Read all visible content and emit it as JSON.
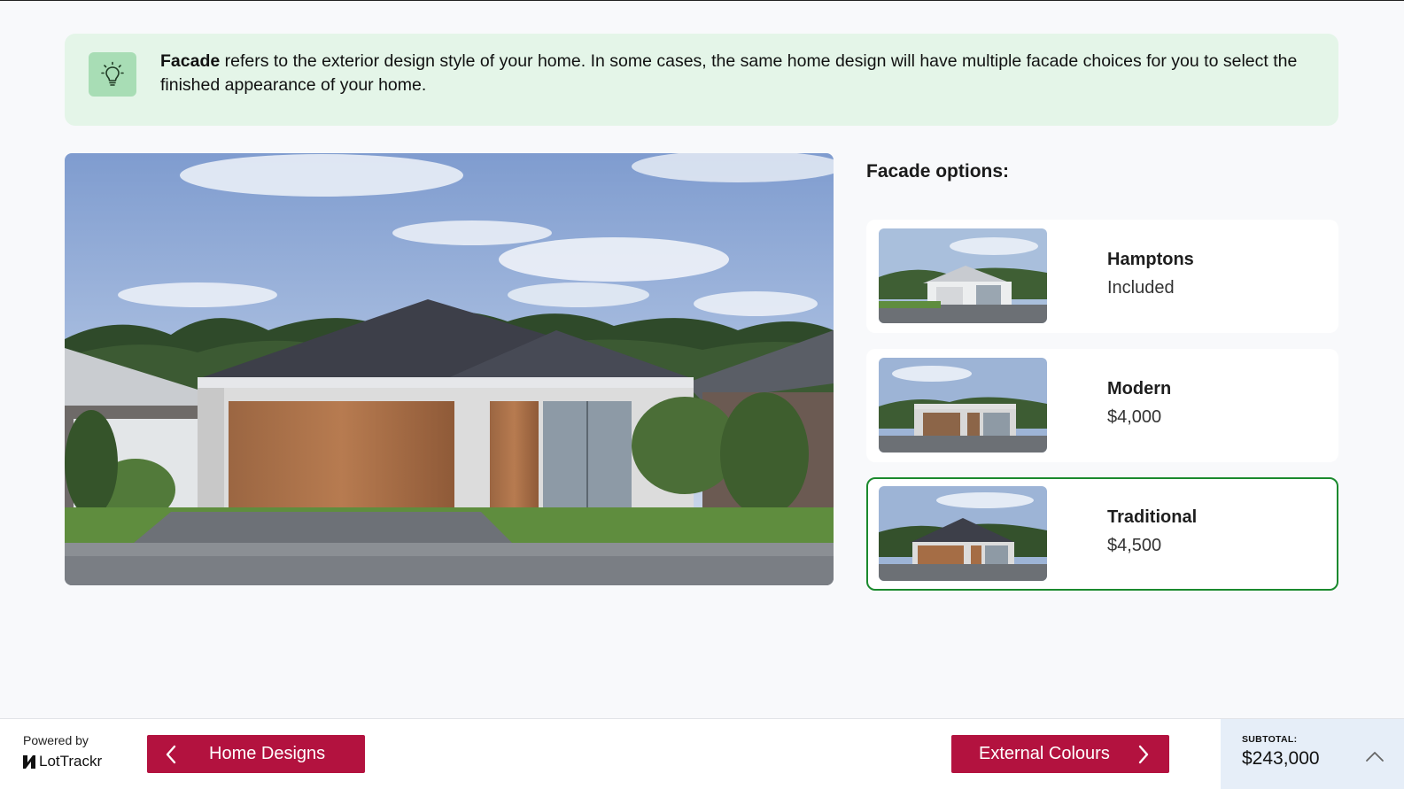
{
  "banner": {
    "icon": "lightbulb-icon",
    "bold": "Facade",
    "text": " refers to the exterior design style of your home. In some cases, the same home design will have multiple facade choices for you to select the finished appearance of your home."
  },
  "options_title": "Facade options:",
  "options": [
    {
      "name": "Hamptons",
      "price": "Included",
      "selected": false
    },
    {
      "name": "Modern",
      "price": "$4,000",
      "selected": false
    },
    {
      "name": "Traditional",
      "price": "$4,500",
      "selected": true
    }
  ],
  "footer": {
    "powered_by": "Powered by",
    "brand": "LotTrackr",
    "back_label": "Home Designs",
    "next_label": "External Colours",
    "subtotal_label": "SUBTOTAL:",
    "subtotal_value": "$243,000"
  },
  "colors": {
    "accent": "#b3123f",
    "selected_border": "#1b8a2e",
    "banner_bg": "#e4f5e8",
    "subtotal_bg": "#e6eef8"
  }
}
